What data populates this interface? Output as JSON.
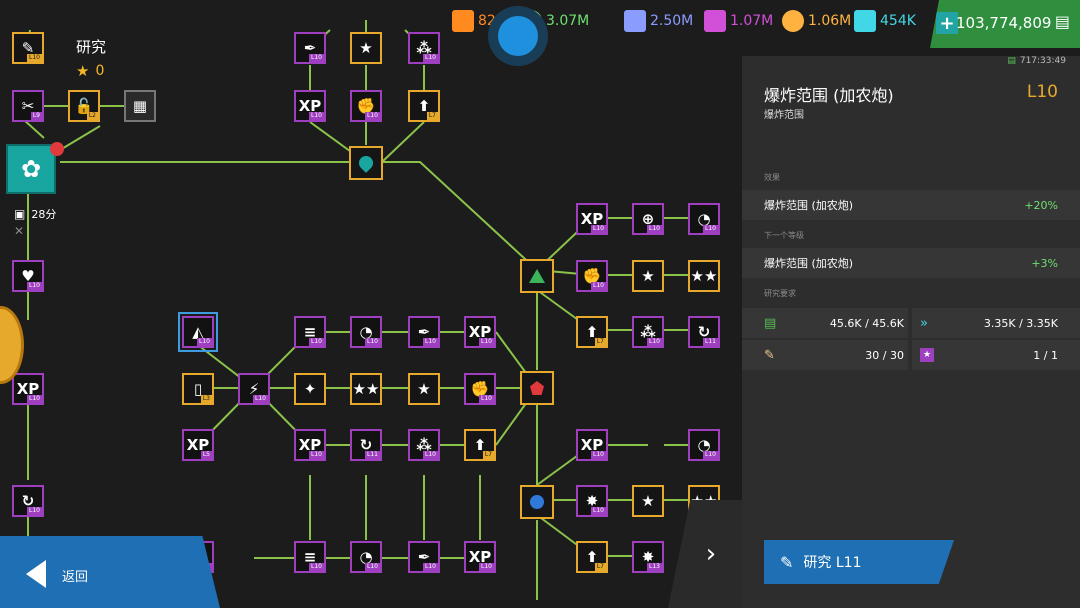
{
  "colors": {
    "purple": "#9d3fbf",
    "gold": "#e7a92b",
    "line": "#8bc34a",
    "blue": "#1e6fb3",
    "green_money": "#2f8f3e"
  },
  "resources": [
    {
      "icon": "orange-hex-icon",
      "value": "826",
      "color": "#ff8a1f"
    },
    {
      "icon": "green-circle-icon",
      "value": "3.07M",
      "color": "#6ee06e"
    },
    {
      "icon": "blue-triangle-icon",
      "value": "2.50M",
      "color": "#8b9cff"
    },
    {
      "icon": "purple-stripe-icon",
      "value": "1.07M",
      "color": "#d24fd8"
    },
    {
      "icon": "orange-ball-icon",
      "value": "1.06M",
      "color": "#ffb23f"
    },
    {
      "icon": "cyan-chevron-icon",
      "value": "454K",
      "color": "#42d7e6"
    }
  ],
  "money": {
    "value": "103,774,809"
  },
  "left": {
    "title": "研究",
    "stars": "0",
    "timer": "28分",
    "back_label": "返回"
  },
  "panel": {
    "timer": "717:33:49",
    "title": "爆炸范围 (加农炮)",
    "subtitle": "爆炸范围",
    "level": "L10",
    "effect_header": "效果",
    "effect_label": "爆炸范围 (加农炮)",
    "effect_value": "+20%",
    "next_header": "下一个等级",
    "next_label": "爆炸范围 (加农炮)",
    "next_value": "+3%",
    "req_header": "研究要求",
    "req": [
      {
        "icon": "cash-icon",
        "value": "45.6K / 45.6K"
      },
      {
        "icon": "cyan-chevron-icon",
        "value": "3.35K / 3.35K"
      },
      {
        "icon": "flask-icon",
        "value": "30 / 30"
      },
      {
        "icon": "star-card-icon",
        "value": "1 / 1"
      }
    ],
    "research_label": "研究 L11"
  },
  "nodes": [
    {
      "id": "n-a1",
      "glyph": "✒",
      "lvl": "L10",
      "c": "purple"
    },
    {
      "id": "n-a2",
      "glyph": "★",
      "lvl": "",
      "c": "gold"
    },
    {
      "id": "n-a3",
      "glyph": "⁂",
      "lvl": "L10",
      "c": "purple"
    },
    {
      "id": "n-b1",
      "glyph": "XP",
      "lvl": "L10",
      "c": "purple"
    },
    {
      "id": "n-b2",
      "glyph": "✊",
      "lvl": "L10",
      "c": "purple"
    },
    {
      "id": "n-b3",
      "glyph": "⬆",
      "lvl": "L7",
      "c": "gold"
    },
    {
      "id": "n-l1",
      "glyph": "✎",
      "lvl": "L10",
      "c": "gold"
    },
    {
      "id": "n-l2",
      "glyph": "✂",
      "lvl": "L9",
      "c": "purple"
    },
    {
      "id": "n-l3",
      "glyph": "🔓",
      "lvl": "L2",
      "c": "gold"
    },
    {
      "id": "n-l4",
      "glyph": "▦",
      "lvl": "",
      "c": "grey"
    },
    {
      "id": "n-l5",
      "glyph": "♥",
      "lvl": "L10",
      "c": "purple"
    },
    {
      "id": "n-l6",
      "glyph": "XP",
      "lvl": "L10",
      "c": "purple"
    },
    {
      "id": "n-l7",
      "glyph": "↻",
      "lvl": "L10",
      "c": "purple"
    },
    {
      "id": "n-r1",
      "glyph": "XP",
      "lvl": "L10",
      "c": "purple"
    },
    {
      "id": "n-r2",
      "glyph": "⊕",
      "lvl": "L10",
      "c": "purple"
    },
    {
      "id": "n-r3",
      "glyph": "◔",
      "lvl": "L10",
      "c": "purple"
    },
    {
      "id": "n-r4",
      "glyph": "✊",
      "lvl": "L10",
      "c": "purple"
    },
    {
      "id": "n-r5",
      "glyph": "★",
      "lvl": "",
      "c": "gold"
    },
    {
      "id": "n-r6",
      "glyph": "★★",
      "lvl": "",
      "c": "gold"
    },
    {
      "id": "n-r7",
      "glyph": "⬆",
      "lvl": "L7",
      "c": "gold"
    },
    {
      "id": "n-r8",
      "glyph": "⁂",
      "lvl": "L10",
      "c": "purple"
    },
    {
      "id": "n-r9",
      "glyph": "↻",
      "lvl": "L11",
      "c": "purple"
    },
    {
      "id": "n-m1",
      "glyph": "◭",
      "lvl": "L10",
      "c": "purple"
    },
    {
      "id": "n-m2",
      "glyph": "≡",
      "lvl": "L10",
      "c": "purple"
    },
    {
      "id": "n-m3",
      "glyph": "◔",
      "lvl": "L10",
      "c": "purple"
    },
    {
      "id": "n-m4",
      "glyph": "✒",
      "lvl": "L10",
      "c": "purple"
    },
    {
      "id": "n-m5",
      "glyph": "XP",
      "lvl": "L10",
      "c": "purple"
    },
    {
      "id": "n-m6",
      "glyph": "▯",
      "lvl": "L3",
      "c": "gold"
    },
    {
      "id": "n-m7",
      "glyph": "⚡",
      "lvl": "L10",
      "c": "purple"
    },
    {
      "id": "n-m8",
      "glyph": "✦",
      "lvl": "",
      "c": "gold"
    },
    {
      "id": "n-m9",
      "glyph": "★★",
      "lvl": "",
      "c": "gold"
    },
    {
      "id": "n-m10",
      "glyph": "★",
      "lvl": "",
      "c": "gold"
    },
    {
      "id": "n-m11",
      "glyph": "✊",
      "lvl": "L10",
      "c": "purple"
    },
    {
      "id": "n-m12",
      "glyph": "XP",
      "lvl": "L5",
      "c": "purple"
    },
    {
      "id": "n-m13",
      "glyph": "XP",
      "lvl": "L10",
      "c": "purple"
    },
    {
      "id": "n-m14",
      "glyph": "↻",
      "lvl": "L11",
      "c": "purple"
    },
    {
      "id": "n-m15",
      "glyph": "⁂",
      "lvl": "L10",
      "c": "purple"
    },
    {
      "id": "n-m16",
      "glyph": "⬆",
      "lvl": "L7",
      "c": "gold"
    },
    {
      "id": "n-s1",
      "glyph": "XP",
      "lvl": "L10",
      "c": "purple"
    },
    {
      "id": "n-s2",
      "glyph": "◔",
      "lvl": "L10",
      "c": "purple"
    },
    {
      "id": "n-s3",
      "glyph": "✸",
      "lvl": "L10",
      "c": "purple"
    },
    {
      "id": "n-s4",
      "glyph": "★",
      "lvl": "",
      "c": "gold"
    },
    {
      "id": "n-s5",
      "glyph": "★★",
      "lvl": "",
      "c": "gold"
    },
    {
      "id": "n-s6",
      "glyph": "⬆",
      "lvl": "L7",
      "c": "gold"
    },
    {
      "id": "n-s7",
      "glyph": "✸",
      "lvl": "L13",
      "c": "purple"
    },
    {
      "id": "n-b4",
      "glyph": "≡",
      "lvl": "L10",
      "c": "purple"
    },
    {
      "id": "n-b5",
      "glyph": "◔",
      "lvl": "L10",
      "c": "purple"
    },
    {
      "id": "n-b6",
      "glyph": "✒",
      "lvl": "L10",
      "c": "purple"
    },
    {
      "id": "n-b7",
      "glyph": "XP",
      "lvl": "L10",
      "c": "purple"
    },
    {
      "id": "n-l8",
      "glyph": "↻",
      "lvl": "L10",
      "c": "purple"
    }
  ]
}
